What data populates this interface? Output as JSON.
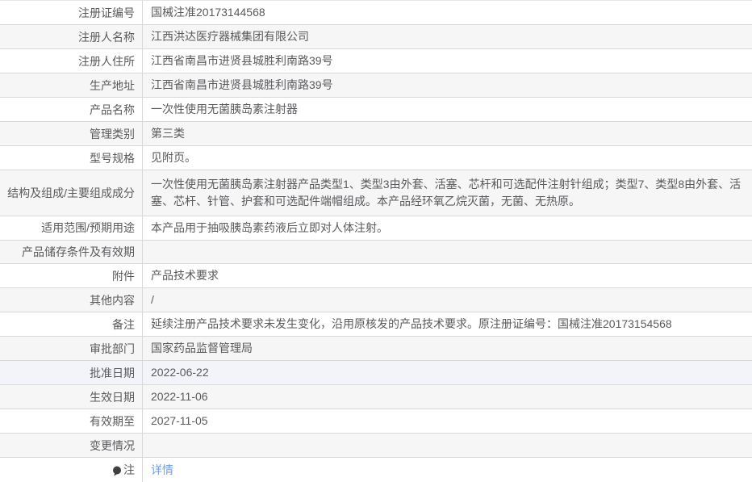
{
  "page": {
    "type": "medical-device-registration-detail-table"
  },
  "colors": {
    "row_stripe": "#f6f6f7",
    "row_highlight": "#f2f4f9",
    "border": "#d9d9d9",
    "text": "#595a5c",
    "link": "#6d9eea",
    "icon": "#3f4040"
  },
  "table": {
    "rows": [
      {
        "label": "注册证编号",
        "value": "国械注准20173144568"
      },
      {
        "label": "注册人名称",
        "value": "江西洪达医疗器械集团有限公司"
      },
      {
        "label": "注册人住所",
        "value": "江西省南昌市进贤县城胜利南路39号"
      },
      {
        "label": "生产地址",
        "value": "江西省南昌市进贤县城胜利南路39号"
      },
      {
        "label": "产品名称",
        "value": "一次性使用无菌胰岛素注射器"
      },
      {
        "label": "管理类别",
        "value": "第三类"
      },
      {
        "label": "型号规格",
        "value": "见附页。"
      },
      {
        "label": "结构及组成/主要组成成分",
        "value": "一次性使用无菌胰岛素注射器产品类型1、类型3由外套、活塞、芯杆和可选配件注射针组成；类型7、类型8由外套、活塞、芯杆、针管、护套和可选配件端帽组成。本产品经环氧乙烷灭菌，无菌、无热原。",
        "tall": true
      },
      {
        "label": "适用范围/预期用途",
        "value": "本产品用于抽吸胰岛素药液后立即对人体注射。"
      },
      {
        "label": "产品储存条件及有效期",
        "value": ""
      },
      {
        "label": "附件",
        "value": "产品技术要求"
      },
      {
        "label": "其他内容",
        "value": "/"
      },
      {
        "label": "备注",
        "value": "延续注册产品技术要求未发生变化，沿用原核发的产品技术要求。原注册证编号：国械注准20173154568"
      },
      {
        "label": "审批部门",
        "value": "国家药品监督管理局"
      },
      {
        "label": "批准日期",
        "value": "2022-06-22",
        "highlighted": true
      },
      {
        "label": "生效日期",
        "value": "2022-11-06"
      },
      {
        "label": "有效期至",
        "value": "2027-11-05"
      },
      {
        "label": "变更情况",
        "value": ""
      },
      {
        "label": "注",
        "value": "详情",
        "value_is_link": true,
        "label_icon": "comment-icon"
      }
    ]
  }
}
